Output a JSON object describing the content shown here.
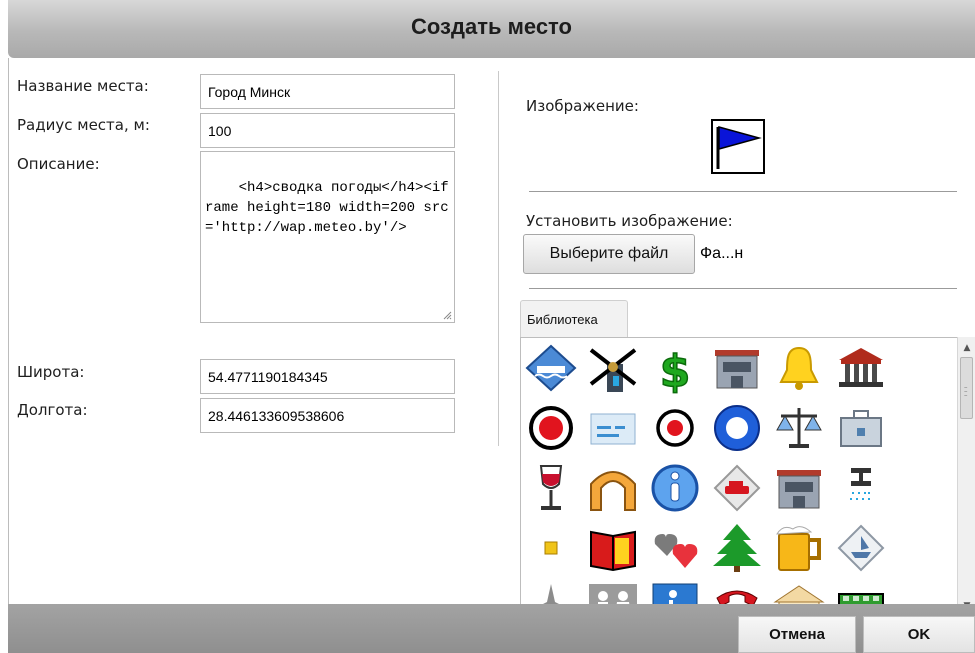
{
  "dialog": {
    "title": "Создать место"
  },
  "form": {
    "name_label": "Название места:",
    "name_value": "Город Минск",
    "radius_label": "Радиус места, м:",
    "radius_value": "100",
    "description_label": "Описание:",
    "description_value": "<h4>сводка погоды</h4><iframe height=180 width=200 src='http://wap.meteo.by'/>",
    "latitude_label": "Широта:",
    "latitude_value": "54.4771190184345",
    "longitude_label": "Долгота:",
    "longitude_value": "28.446133609538606"
  },
  "image_panel": {
    "image_label": "Изображение:",
    "current_icon": "blue-flag-icon",
    "set_image_label": "Установить изображение:",
    "choose_file_button": "Выберите файл",
    "file_status": "Фа...н",
    "library_tab": "Библиотека",
    "library_icons": [
      "boat-sign-icon",
      "windmill-icon",
      "dollar-icon",
      "building-icon",
      "bell-icon",
      "bank-icon",
      "red-dot-large-icon",
      "sign-icon",
      "red-dot-small-icon",
      "blue-circle-icon",
      "scales-icon",
      "briefcase-icon",
      "wine-icon",
      "tunnel-icon",
      "info-icon",
      "car-sign-icon",
      "office-icon",
      "shower-icon",
      "small-square-icon",
      "book-icon",
      "hearts-icon",
      "tree-icon",
      "beer-icon",
      "ship-sign-icon",
      "airplane-icon",
      "restroom-icon",
      "disabled-icon",
      "telephone-icon",
      "temple-icon",
      "bus-icon"
    ]
  },
  "footer": {
    "cancel_button": "Отмена",
    "ok_button": "OK"
  },
  "colors": {
    "accent_blue": "#0a14d8",
    "header_gray": "#b8b8b8",
    "footer_gray": "#999999"
  }
}
